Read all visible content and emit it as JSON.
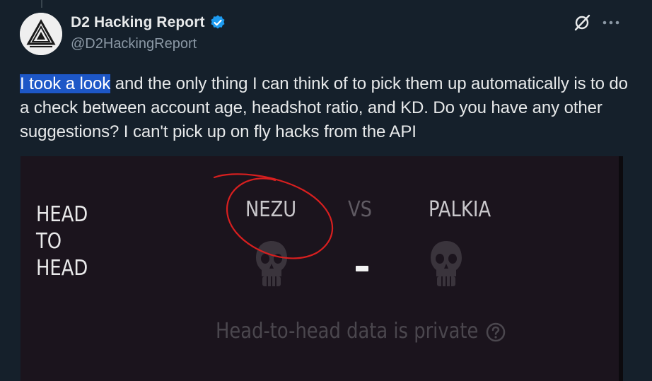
{
  "author": {
    "display_name": "D2 Hacking Report",
    "handle": "@D2HackingReport"
  },
  "tweet": {
    "text_highlighted": "I took a look",
    "text_rest": " and the only thing I can think of to pick them up automatically is to do a check between account age, headshot ratio, and KD. Do you have any other suggestions? I can't pick up on fly hacks from the API"
  },
  "media": {
    "h2h_line1": "HEAD",
    "h2h_line2": "TO",
    "h2h_line3": "HEAD",
    "player_a": "NEZU",
    "vs": "VS",
    "player_b": "PALKIA",
    "score": "-",
    "private_text": "Head-to-head data is private"
  },
  "icons": {
    "verified": "verified-badge-icon",
    "grok": "grok-icon",
    "more": "more-options-icon",
    "skull": "skull-icon",
    "info": "question-circle-icon"
  },
  "colors": {
    "background": "#15202b",
    "text_primary": "#e7e9ea",
    "text_secondary": "#8b98a5",
    "verified": "#1d9bf0",
    "selection": "#1d57c7",
    "annotation": "#d81f1f"
  }
}
